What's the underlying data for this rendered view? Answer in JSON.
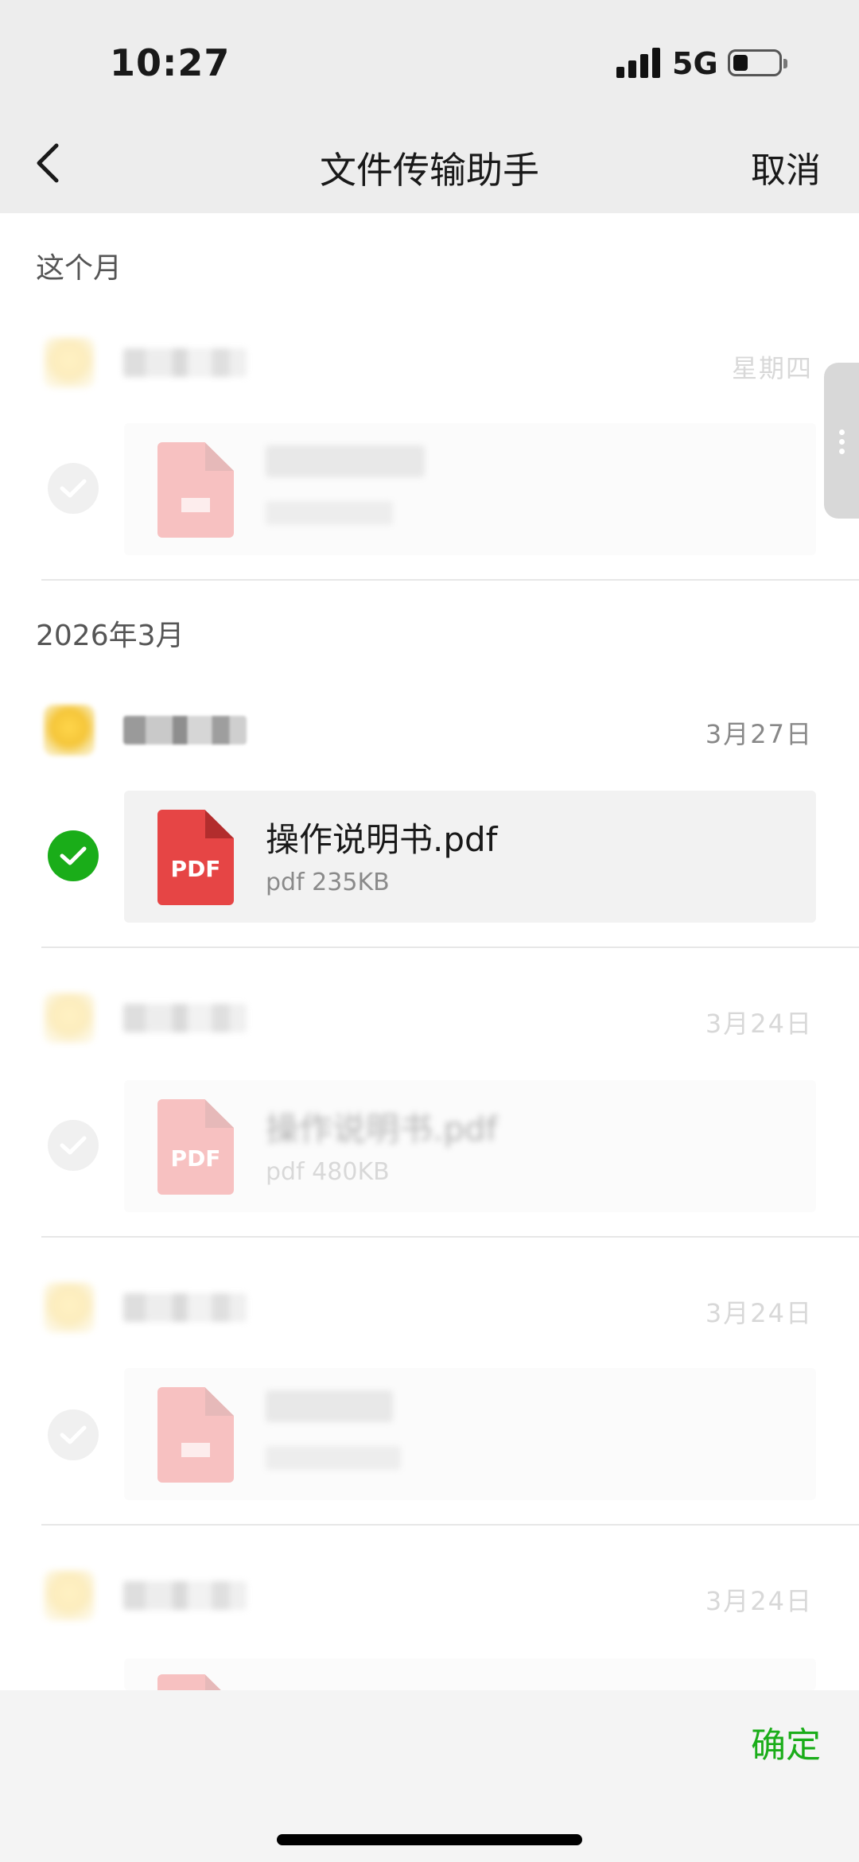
{
  "status_bar": {
    "time": "10:27",
    "network": "5G"
  },
  "nav": {
    "title": "文件传输助手",
    "cancel": "取消"
  },
  "sections": [
    {
      "title": "这个月"
    },
    {
      "title": "2026年3月"
    }
  ],
  "messages": [
    {
      "date": "星期四",
      "file_name": "",
      "file_meta": "",
      "selected": false,
      "dimmed": true
    },
    {
      "date": "3月27日",
      "file_name": "操作说明书.pdf",
      "file_meta": "pdf 235KB",
      "selected": true,
      "dimmed": false,
      "icon_label": "PDF"
    },
    {
      "date": "3月24日",
      "file_name": "操作说明书.pdf",
      "file_meta": "pdf 480KB",
      "selected": false,
      "dimmed": true,
      "icon_label": "PDF"
    },
    {
      "date": "3月24日",
      "file_name": "",
      "file_meta": "",
      "selected": false,
      "dimmed": true
    },
    {
      "date": "3月24日",
      "file_name": "",
      "file_meta": "",
      "selected": false,
      "dimmed": true
    }
  ],
  "bottom_bar": {
    "confirm": "确定"
  },
  "colors": {
    "accent_green": "#1aad19",
    "pdf_red": "#e64545",
    "topbar_bg": "#ededed"
  }
}
